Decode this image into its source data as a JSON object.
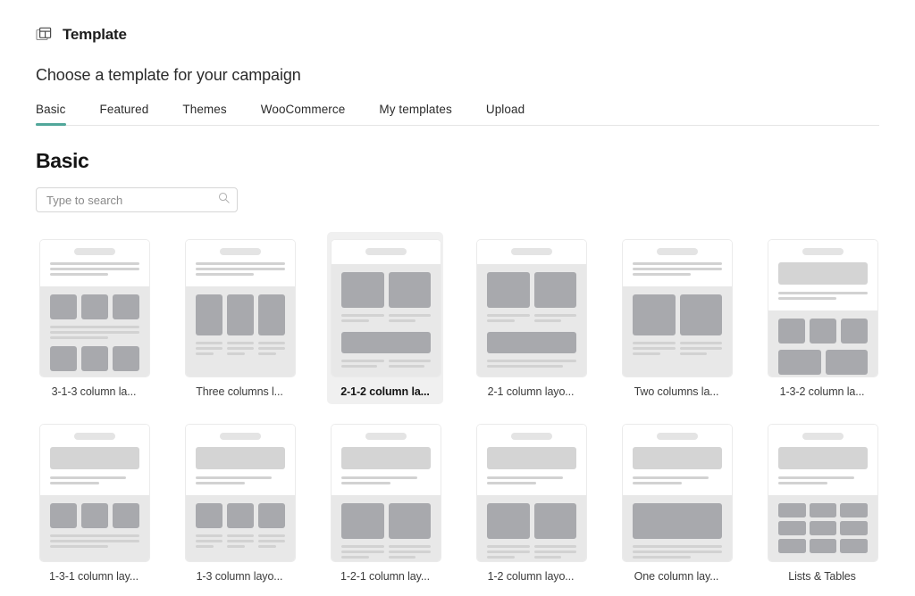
{
  "header": {
    "icon": "template-layout-icon",
    "title": "Template",
    "subtitle": "Choose a template for your campaign"
  },
  "tabs": {
    "active_index": 0,
    "active_color": "#51a79a",
    "items": [
      {
        "label": "Basic"
      },
      {
        "label": "Featured"
      },
      {
        "label": "Themes"
      },
      {
        "label": "WooCommerce"
      },
      {
        "label": "My templates"
      },
      {
        "label": "Upload"
      }
    ]
  },
  "section": {
    "title": "Basic"
  },
  "search": {
    "placeholder": "Type to search",
    "value": "",
    "icon": "search-icon"
  },
  "templates": {
    "selected_index": 2,
    "items": [
      {
        "label": "3-1-3 column la...",
        "layout": "3-1-3"
      },
      {
        "label": "Three columns l...",
        "layout": "three-columns"
      },
      {
        "label": "2-1-2 column la...",
        "layout": "2-1-2"
      },
      {
        "label": "2-1 column layo...",
        "layout": "2-1"
      },
      {
        "label": "Two columns la...",
        "layout": "two-columns"
      },
      {
        "label": "1-3-2 column la...",
        "layout": "1-3-2"
      },
      {
        "label": "1-3-1 column lay...",
        "layout": "1-3-1"
      },
      {
        "label": "1-3 column layo...",
        "layout": "1-3"
      },
      {
        "label": "1-2-1 column lay...",
        "layout": "1-2-1"
      },
      {
        "label": "1-2 column layo...",
        "layout": "1-2"
      },
      {
        "label": "One column lay...",
        "layout": "one-column"
      },
      {
        "label": "Lists & Tables",
        "layout": "lists-tables"
      }
    ]
  }
}
